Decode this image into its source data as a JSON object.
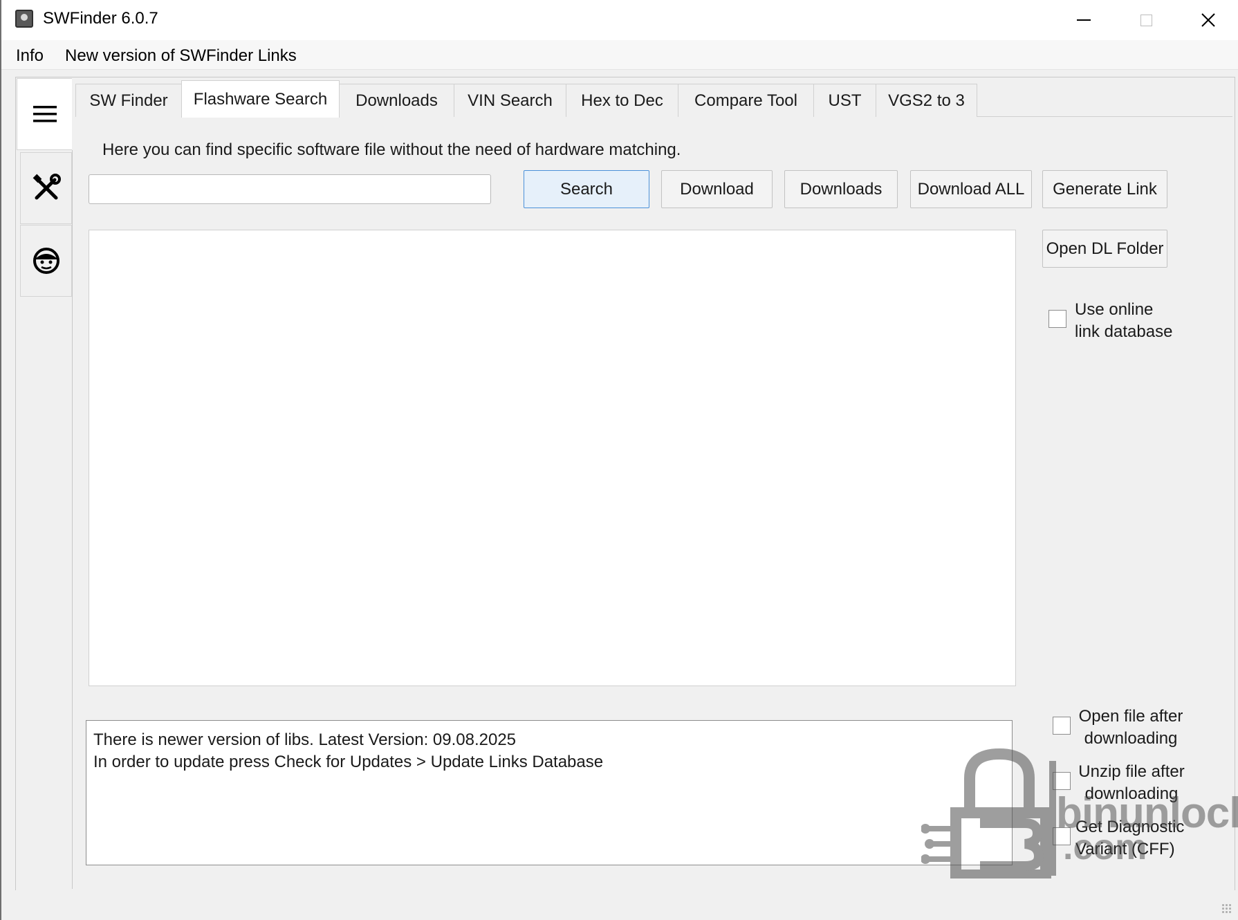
{
  "window": {
    "title": "SWFinder 6.0.7",
    "icon": "app-icon"
  },
  "menu": {
    "info": "Info",
    "new_version": "New version of SWFinder Links"
  },
  "sidebar": {
    "items": [
      {
        "name": "menu",
        "icon": "hamburger-icon"
      },
      {
        "name": "tools",
        "icon": "tools-icon"
      },
      {
        "name": "support",
        "icon": "support-icon"
      }
    ]
  },
  "tabs": [
    {
      "label": "SW Finder",
      "active": false
    },
    {
      "label": "Flashware Search",
      "active": true
    },
    {
      "label": "Downloads",
      "active": false
    },
    {
      "label": "VIN Search",
      "active": false
    },
    {
      "label": "Hex to Dec",
      "active": false
    },
    {
      "label": "Compare Tool",
      "active": false
    },
    {
      "label": "UST",
      "active": false
    },
    {
      "label": "VGS2 to 3",
      "active": false
    }
  ],
  "panel": {
    "description": "Here you can find specific software file without the need of hardware matching.",
    "search_value": "",
    "buttons": {
      "search": "Search",
      "download": "Download",
      "downloads": "Downloads",
      "download_all": "Download ALL",
      "generate_link": "Generate Link",
      "open_dl_folder": "Open DL Folder"
    },
    "use_online_db": {
      "line1": "Use online",
      "line2": "link database",
      "checked": false
    },
    "options": [
      {
        "line1": "Open file after",
        "line2": "downloading",
        "checked": false
      },
      {
        "line1": "Unzip file after",
        "line2": "downloading",
        "checked": false
      },
      {
        "line1": "Get Diagnostic",
        "line2": "Variant (CFF)",
        "checked": false
      }
    ],
    "log": {
      "line1": "There is newer version of libs. Latest Version: 09.08.2025",
      "line2": "In order to update press Check for Updates > Update Links Database"
    }
  },
  "watermark": {
    "line1": "binunlock",
    "line2": ".com"
  }
}
